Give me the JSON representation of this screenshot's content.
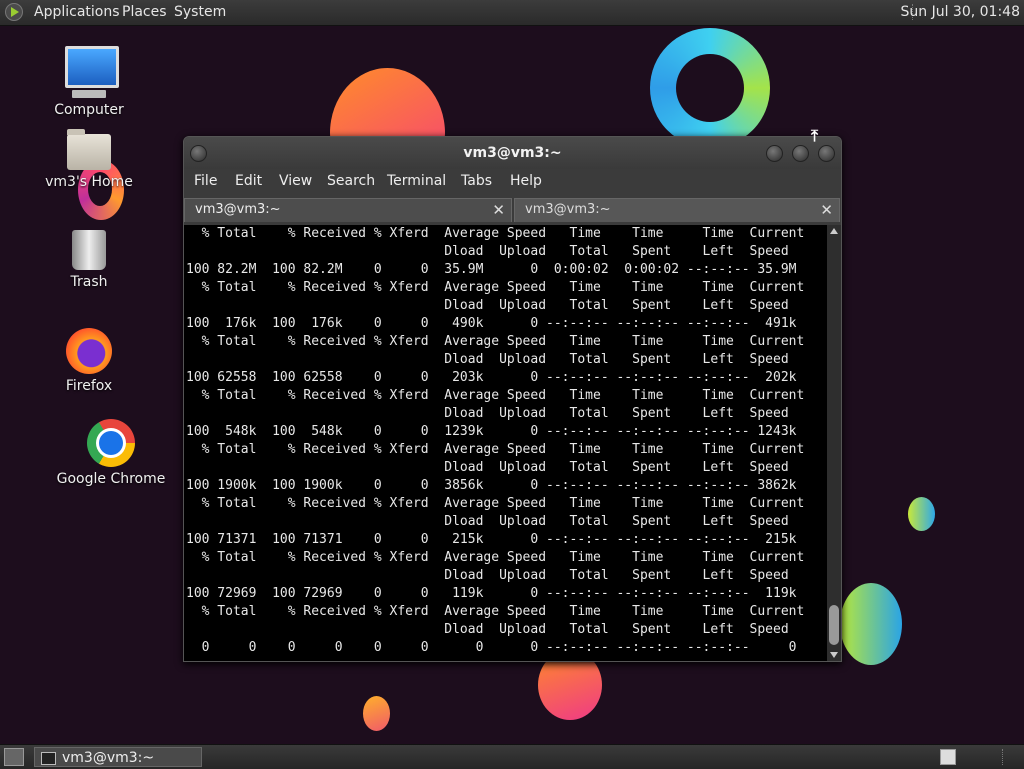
{
  "top_panel": {
    "menus": [
      "Applications",
      "Places",
      "System"
    ],
    "clock": "Sun Jul 30, 01:48"
  },
  "desktop_icons": [
    {
      "label": "Computer",
      "icon": "computer-icon"
    },
    {
      "label": "vm3's Home",
      "icon": "home-folder-icon"
    },
    {
      "label": "Trash",
      "icon": "trash-icon"
    },
    {
      "label": "Firefox",
      "icon": "firefox-icon"
    },
    {
      "label": "Google Chrome",
      "icon": "chrome-icon"
    }
  ],
  "terminal": {
    "title": "vm3@vm3:~",
    "menu": [
      "File",
      "Edit",
      "View",
      "Search",
      "Terminal",
      "Tabs",
      "Help"
    ],
    "tabs": [
      {
        "label": "vm3@vm3:~",
        "active": true
      },
      {
        "label": "vm3@vm3:~",
        "active": false
      }
    ],
    "output": "  % Total    % Received % Xferd  Average Speed   Time    Time     Time  Current\n                                 Dload  Upload   Total   Spent    Left  Speed\n100 82.2M  100 82.2M    0     0  35.9M      0  0:00:02  0:00:02 --:--:-- 35.9M\n  % Total    % Received % Xferd  Average Speed   Time    Time     Time  Current\n                                 Dload  Upload   Total   Spent    Left  Speed\n100  176k  100  176k    0     0   490k      0 --:--:-- --:--:-- --:--:--  491k\n  % Total    % Received % Xferd  Average Speed   Time    Time     Time  Current\n                                 Dload  Upload   Total   Spent    Left  Speed\n100 62558  100 62558    0     0   203k      0 --:--:-- --:--:-- --:--:--  202k\n  % Total    % Received % Xferd  Average Speed   Time    Time     Time  Current\n                                 Dload  Upload   Total   Spent    Left  Speed\n100  548k  100  548k    0     0  1239k      0 --:--:-- --:--:-- --:--:-- 1243k\n  % Total    % Received % Xferd  Average Speed   Time    Time     Time  Current\n                                 Dload  Upload   Total   Spent    Left  Speed\n100 1900k  100 1900k    0     0  3856k      0 --:--:-- --:--:-- --:--:-- 3862k\n  % Total    % Received % Xferd  Average Speed   Time    Time     Time  Current\n                                 Dload  Upload   Total   Spent    Left  Speed\n100 71371  100 71371    0     0   215k      0 --:--:-- --:--:-- --:--:--  215k\n  % Total    % Received % Xferd  Average Speed   Time    Time     Time  Current\n                                 Dload  Upload   Total   Spent    Left  Speed\n100 72969  100 72969    0     0   119k      0 --:--:-- --:--:-- --:--:--  119k\n  % Total    % Received % Xferd  Average Speed   Time    Time     Time  Current\n                                 Dload  Upload   Total   Spent    Left  Speed\n  0     0    0     0    0     0      0      0 --:--:-- --:--:-- --:--:--     0"
  },
  "taskbar": {
    "window_button": "vm3@vm3:~"
  }
}
